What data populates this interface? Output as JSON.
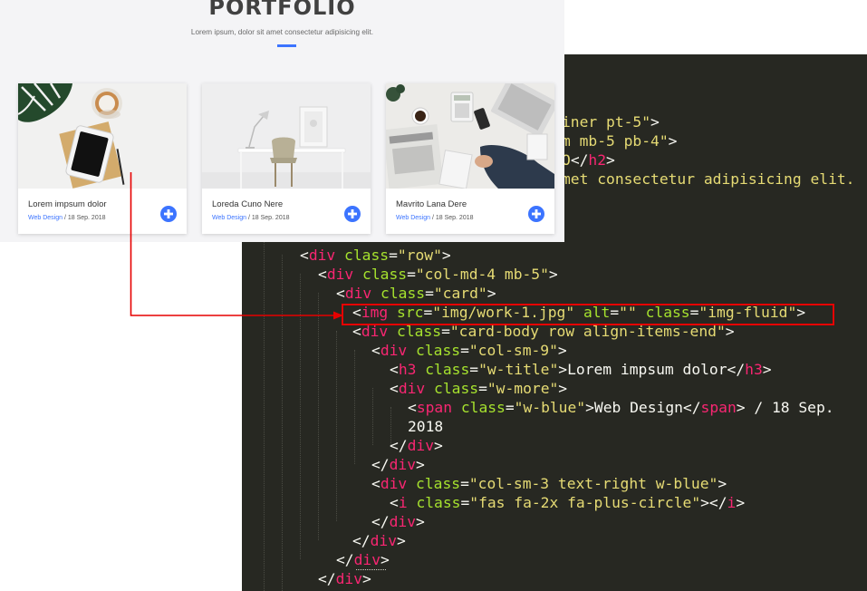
{
  "portfolio": {
    "title": "PORTFOLIO",
    "subtitle": "Lorem ipsum, dolor sit amet consectetur adipisicing elit.",
    "accent_color": "#3c74ff",
    "cards": [
      {
        "title": "Lorem impsum dolor",
        "category": "Web Design",
        "date": " / 18 Sep. 2018",
        "image": "plant-tablet-coffee-desk"
      },
      {
        "title": "Loreda Cuno Nere",
        "category": "Web Design",
        "date": " / 18 Sep. 2018",
        "image": "white-desk-chair"
      },
      {
        "title": "Mavrito Lana Dere",
        "category": "Web Design",
        "date": " / 18 Sep. 2018",
        "image": "laptop-newspaper-calculator"
      }
    ],
    "plus_icon": "plus-circle-icon"
  },
  "editor": {
    "highlight_color": "#e60000",
    "lines": [
      [
        [
          "t-str",
          "iner pt-5\""
        ],
        [
          "t-plain",
          ">"
        ]
      ],
      [
        [
          "t-str",
          "m mb-5 pb-4\""
        ],
        [
          "t-plain",
          ">"
        ]
      ],
      [
        [
          "t-str",
          "O"
        ],
        [
          "t-plain",
          "</"
        ],
        [
          "t-tag",
          "h2"
        ],
        [
          "t-plain",
          ">"
        ]
      ],
      [
        [
          "t-str",
          "met consectetur adipisicing elit."
        ]
      ],
      [
        [
          "t-plain",
          "<"
        ],
        [
          "t-tag",
          "div"
        ],
        [
          "t-plain",
          " "
        ],
        [
          "t-attr",
          "class"
        ],
        [
          "t-plain",
          "="
        ],
        [
          "t-str",
          "\"row\""
        ],
        [
          "t-plain",
          ">"
        ]
      ],
      [
        [
          "t-plain",
          "<"
        ],
        [
          "t-tag",
          "div"
        ],
        [
          "t-plain",
          " "
        ],
        [
          "t-attr",
          "class"
        ],
        [
          "t-plain",
          "="
        ],
        [
          "t-str",
          "\"col-md-4 mb-5\""
        ],
        [
          "t-plain",
          ">"
        ]
      ],
      [
        [
          "t-plain",
          "<"
        ],
        [
          "t-tag",
          "div"
        ],
        [
          "t-plain",
          " "
        ],
        [
          "t-attr",
          "class"
        ],
        [
          "t-plain",
          "="
        ],
        [
          "t-str",
          "\"card\""
        ],
        [
          "t-plain",
          ">"
        ]
      ],
      [
        [
          "t-plain",
          "<"
        ],
        [
          "t-tag",
          "img"
        ],
        [
          "t-plain",
          " "
        ],
        [
          "t-attr",
          "src"
        ],
        [
          "t-plain",
          "="
        ],
        [
          "t-str",
          "\"img/work-1.jpg\""
        ],
        [
          "t-plain",
          " "
        ],
        [
          "t-attr",
          "alt"
        ],
        [
          "t-plain",
          "="
        ],
        [
          "t-str",
          "\"\""
        ],
        [
          "t-plain",
          " "
        ],
        [
          "t-attr",
          "class"
        ],
        [
          "t-plain",
          "="
        ],
        [
          "t-str",
          "\"img-fluid\""
        ],
        [
          "t-plain",
          ">"
        ]
      ],
      [
        [
          "t-plain",
          "<"
        ],
        [
          "t-tag",
          "div"
        ],
        [
          "t-plain",
          " "
        ],
        [
          "t-attr",
          "class"
        ],
        [
          "t-plain",
          "="
        ],
        [
          "t-str",
          "\"card-body row align-items-end\""
        ],
        [
          "t-plain",
          ">"
        ]
      ],
      [
        [
          "t-plain",
          "<"
        ],
        [
          "t-tag",
          "div"
        ],
        [
          "t-plain",
          " "
        ],
        [
          "t-attr",
          "class"
        ],
        [
          "t-plain",
          "="
        ],
        [
          "t-str",
          "\"col-sm-9\""
        ],
        [
          "t-plain",
          ">"
        ]
      ],
      [
        [
          "t-plain",
          "<"
        ],
        [
          "t-tag",
          "h3"
        ],
        [
          "t-plain",
          " "
        ],
        [
          "t-attr",
          "class"
        ],
        [
          "t-plain",
          "="
        ],
        [
          "t-str",
          "\"w-title\""
        ],
        [
          "t-plain",
          ">Lorem impsum dolor</"
        ],
        [
          "t-tag",
          "h3"
        ],
        [
          "t-plain",
          ">"
        ]
      ],
      [
        [
          "t-plain",
          "<"
        ],
        [
          "t-tag",
          "div"
        ],
        [
          "t-plain",
          " "
        ],
        [
          "t-attr",
          "class"
        ],
        [
          "t-plain",
          "="
        ],
        [
          "t-str",
          "\"w-more\""
        ],
        [
          "t-plain",
          ">"
        ]
      ],
      [
        [
          "t-plain",
          "<"
        ],
        [
          "t-tag",
          "span"
        ],
        [
          "t-plain",
          " "
        ],
        [
          "t-attr",
          "class"
        ],
        [
          "t-plain",
          "="
        ],
        [
          "t-str",
          "\"w-blue\""
        ],
        [
          "t-plain",
          ">Web Design</"
        ],
        [
          "t-tag",
          "span"
        ],
        [
          "t-plain",
          "> / 18 Sep."
        ]
      ],
      [
        [
          "t-plain",
          "2018"
        ]
      ],
      [
        [
          "t-plain",
          "</"
        ],
        [
          "t-tag",
          "div"
        ],
        [
          "t-plain",
          ">"
        ]
      ],
      [
        [
          "t-plain",
          "</"
        ],
        [
          "t-tag",
          "div"
        ],
        [
          "t-plain",
          ">"
        ]
      ],
      [
        [
          "t-plain",
          "<"
        ],
        [
          "t-tag",
          "div"
        ],
        [
          "t-plain",
          " "
        ],
        [
          "t-attr",
          "class"
        ],
        [
          "t-plain",
          "="
        ],
        [
          "t-str",
          "\"col-sm-3 text-right w-blue\""
        ],
        [
          "t-plain",
          ">"
        ]
      ],
      [
        [
          "t-plain",
          "<"
        ],
        [
          "t-tag",
          "i"
        ],
        [
          "t-plain",
          " "
        ],
        [
          "t-attr",
          "class"
        ],
        [
          "t-plain",
          "="
        ],
        [
          "t-str",
          "\"fas fa-2x fa-plus-circle\""
        ],
        [
          "t-plain",
          "></"
        ],
        [
          "t-tag",
          "i"
        ],
        [
          "t-plain",
          ">"
        ]
      ],
      [
        [
          "t-plain",
          "</"
        ],
        [
          "t-tag",
          "div"
        ],
        [
          "t-plain",
          ">"
        ]
      ],
      [
        [
          "t-plain",
          "</"
        ],
        [
          "t-tag",
          "div"
        ],
        [
          "t-plain",
          ">"
        ]
      ],
      [
        [
          "t-plain",
          "</"
        ],
        [
          "t-tag",
          "div"
        ],
        [
          "t-plain",
          ">"
        ]
      ],
      [
        [
          "t-plain",
          "</"
        ],
        [
          "t-tag",
          "div"
        ],
        [
          "t-plain",
          ">"
        ]
      ]
    ]
  }
}
